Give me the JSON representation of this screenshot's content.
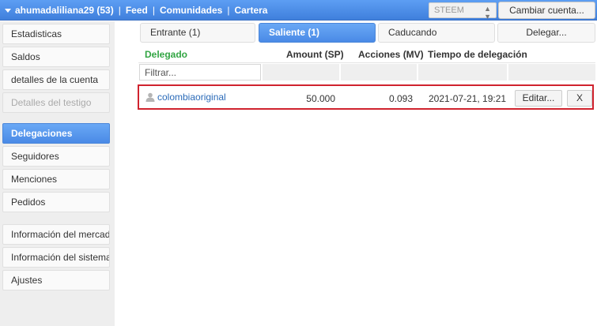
{
  "topbar": {
    "account": "ahumadaliliana29 (53)",
    "feed": "Feed",
    "communities": "Comunidades",
    "wallet": "Cartera",
    "separator": "|",
    "coin": "STEEM",
    "switch_account": "Cambiar cuenta..."
  },
  "sidebar": {
    "items": [
      {
        "label": "Estadisticas"
      },
      {
        "label": "Saldos"
      },
      {
        "label": "detalles de la cuenta"
      },
      {
        "label": "Detalles del testigo"
      },
      {
        "label": "Delegaciones"
      },
      {
        "label": "Seguidores"
      },
      {
        "label": "Menciones"
      },
      {
        "label": "Pedidos"
      },
      {
        "label": "Información del mercado"
      },
      {
        "label": "Información del sistema"
      },
      {
        "label": "Ajustes"
      }
    ]
  },
  "tabs": {
    "incoming": "Entrante (1)",
    "outgoing": "Saliente (1)",
    "expiring": "Caducando",
    "delegate": "Delegar..."
  },
  "table": {
    "headers": {
      "delegatee": "Delegado",
      "amount": "Amount (SP)",
      "shares": "Acciones (MV)",
      "time": "Tiempo de delegación"
    },
    "filter_placeholder": "Filtrar...",
    "rows": [
      {
        "delegatee": "colombiaoriginal",
        "amount": "50.000",
        "shares": "0.093",
        "time": "2021-07-21, 19:21",
        "edit": "Editar...",
        "remove": "X"
      }
    ]
  },
  "colors": {
    "accent": "#4a8ae6",
    "highlight_border": "#d0232e",
    "header_green": "#32a543",
    "link": "#2a6ab8"
  }
}
